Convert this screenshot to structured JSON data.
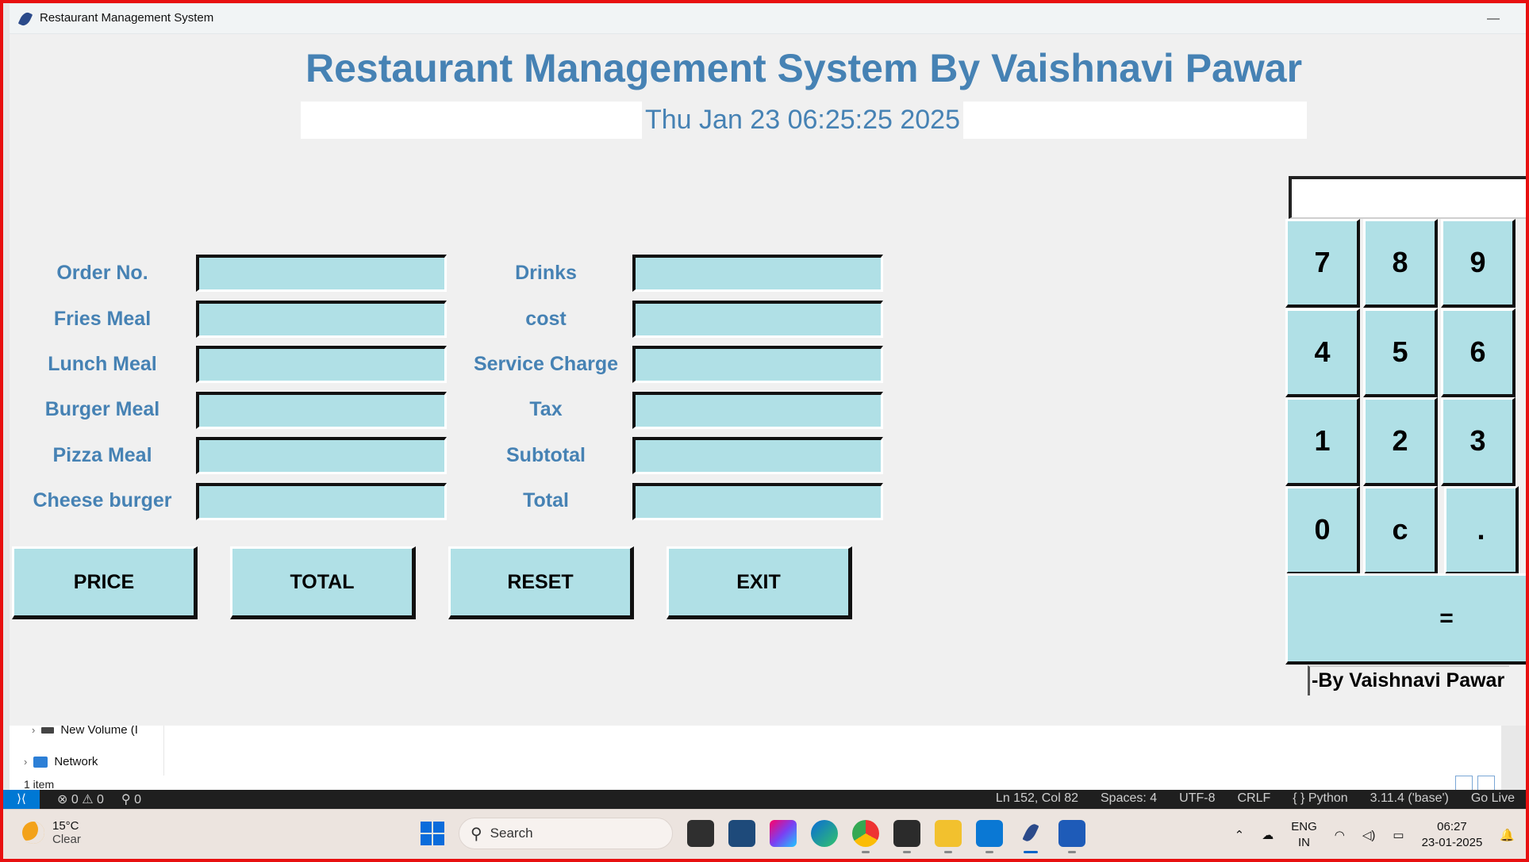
{
  "window": {
    "title": "Restaurant Management System",
    "minimize": "—"
  },
  "heading": "Restaurant Management System By Vaishnavi Pawar",
  "datetime": "Thu Jan 23 06:25:25 2025",
  "left_labels": [
    "Order No.",
    "Fries Meal",
    "Lunch Meal",
    "Burger Meal",
    "Pizza Meal",
    "Cheese burger"
  ],
  "right_labels": [
    "Drinks",
    "cost",
    "Service Charge",
    "Tax",
    "Subtotal",
    "Total"
  ],
  "buttons": {
    "price": "PRICE",
    "total": "TOTAL",
    "reset": "RESET",
    "exit": "EXIT"
  },
  "calculator": {
    "display": "",
    "keys": [
      "7",
      "8",
      "9",
      "4",
      "5",
      "6",
      "1",
      "2",
      "3",
      "0",
      "c",
      "."
    ],
    "equals": "=",
    "byline": "-By Vaishnavi Pawar"
  },
  "explorer": {
    "tree": [
      {
        "label": "New Volume (I"
      },
      {
        "label": "Network"
      }
    ],
    "status": "1 item"
  },
  "vscode_status": {
    "problems": "0",
    "warnings": "0",
    "ports": "0",
    "position": "Ln 152, Col 82",
    "spaces": "Spaces: 4",
    "encoding": "UTF-8",
    "eol": "CRLF",
    "language": "{ } Python",
    "interpreter": "3.11.4 ('base')",
    "golive": "Go Live"
  },
  "taskbar": {
    "temp": "15°C",
    "weather": "Clear",
    "search_placeholder": "Search",
    "lang1": "ENG",
    "lang2": "IN",
    "time": "06:27",
    "date": "23-01-2025"
  },
  "colors": {
    "accent_text": "#4682b4",
    "entry_bg": "#b0e0e6",
    "window_bg": "#f0f0f0"
  }
}
